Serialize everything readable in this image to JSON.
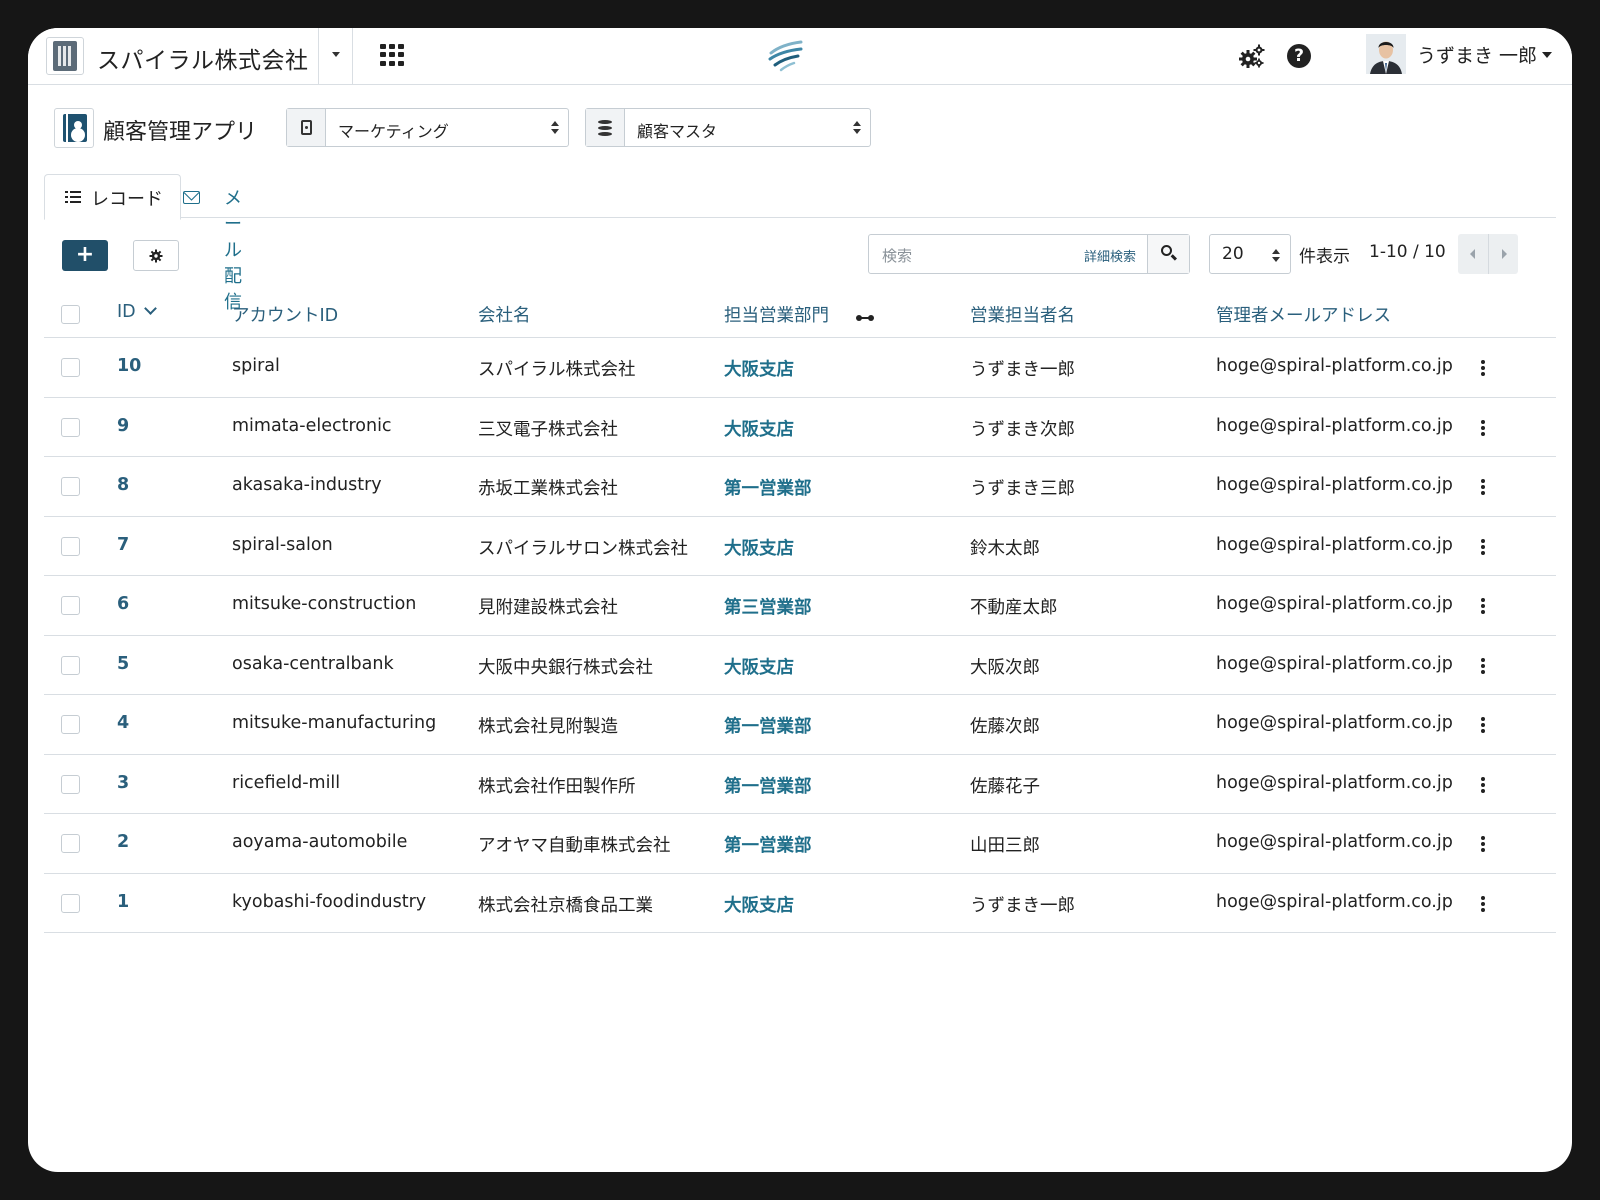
{
  "header": {
    "org_name": "スパイラル株式会社",
    "user_name": "うずまき 一郎",
    "colors": {
      "accent": "#214f69",
      "link": "#2a5f7c"
    }
  },
  "app": {
    "title": "顧客管理アプリ",
    "group_select": "マーケティング",
    "db_select": "顧客マスタ"
  },
  "tabs": [
    {
      "label": "レコード",
      "active": true
    },
    {
      "label": "メール配信",
      "active": false
    }
  ],
  "toolbar": {
    "add_label": "+",
    "search_placeholder": "検索",
    "advanced_search": "詳細検索",
    "per_page": "20",
    "per_page_label": "件表示",
    "range": "1-10 / 10"
  },
  "table": {
    "columns": [
      "ID",
      "アカウントID",
      "会社名",
      "担当営業部門",
      "営業担当者名",
      "管理者メールアドレス"
    ],
    "rows": [
      {
        "id": "10",
        "account": "spiral",
        "company": "スパイラル株式会社",
        "dept": "大阪支店",
        "rep": "うずまき一郎",
        "email": "hoge@spiral-platform.co.jp"
      },
      {
        "id": "9",
        "account": "mimata-electronic",
        "company": "三叉電子株式会社",
        "dept": "大阪支店",
        "rep": "うずまき次郎",
        "email": "hoge@spiral-platform.co.jp"
      },
      {
        "id": "8",
        "account": "akasaka-industry",
        "company": "赤坂工業株式会社",
        "dept": "第一営業部",
        "rep": "うずまき三郎",
        "email": "hoge@spiral-platform.co.jp"
      },
      {
        "id": "7",
        "account": "spiral-salon",
        "company": "スパイラルサロン株式会社",
        "dept": "大阪支店",
        "rep": "鈴木太郎",
        "email": "hoge@spiral-platform.co.jp"
      },
      {
        "id": "6",
        "account": "mitsuke-construction",
        "company": "見附建設株式会社",
        "dept": "第三営業部",
        "rep": "不動産太郎",
        "email": "hoge@spiral-platform.co.jp"
      },
      {
        "id": "5",
        "account": "osaka-centralbank",
        "company": "大阪中央銀行株式会社",
        "dept": "大阪支店",
        "rep": "大阪次郎",
        "email": "hoge@spiral-platform.co.jp"
      },
      {
        "id": "4",
        "account": "mitsuke-manufacturing",
        "company": "株式会社見附製造",
        "dept": "第一営業部",
        "rep": "佐藤次郎",
        "email": "hoge@spiral-platform.co.jp"
      },
      {
        "id": "3",
        "account": "ricefield-mill",
        "company": "株式会社作田製作所",
        "dept": "第一営業部",
        "rep": "佐藤花子",
        "email": "hoge@spiral-platform.co.jp"
      },
      {
        "id": "2",
        "account": "aoyama-automobile",
        "company": "アオヤマ自動車株式会社",
        "dept": "第一営業部",
        "rep": "山田三郎",
        "email": "hoge@spiral-platform.co.jp"
      },
      {
        "id": "1",
        "account": "kyobashi-foodindustry",
        "company": "株式会社京橋食品工業",
        "dept": "大阪支店",
        "rep": "うずまき一郎",
        "email": "hoge@spiral-platform.co.jp"
      }
    ]
  }
}
